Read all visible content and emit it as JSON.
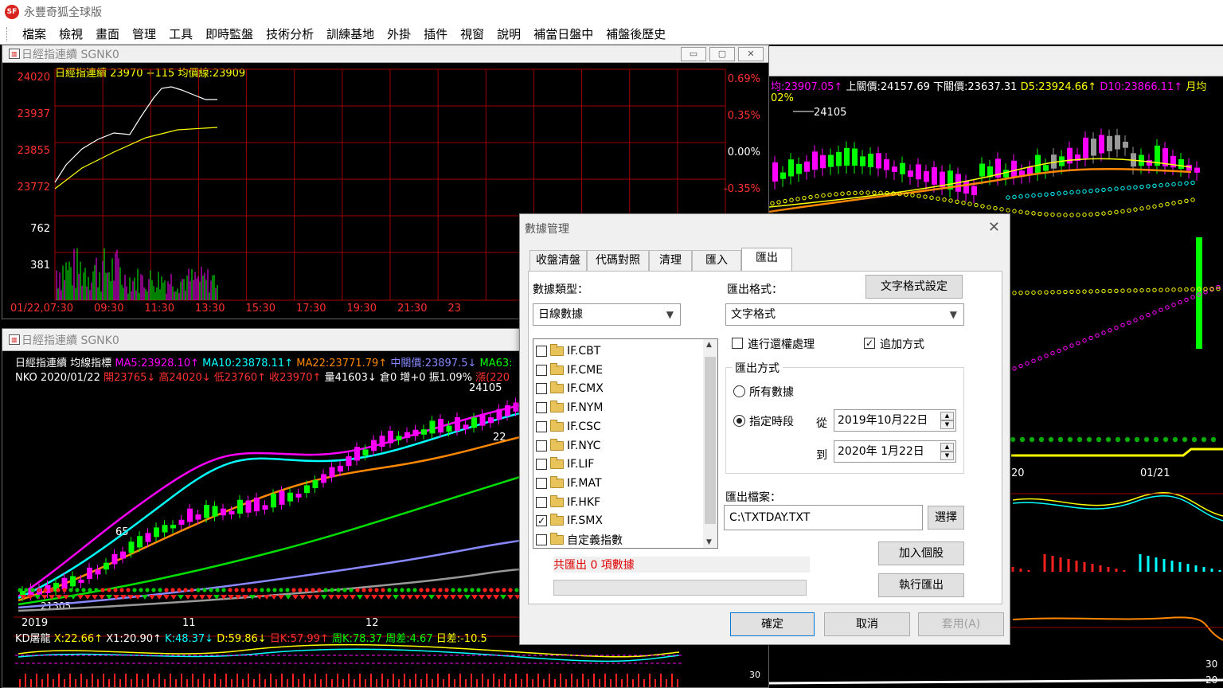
{
  "app": {
    "title": "永豐奇狐全球版",
    "logo": "SF"
  },
  "menu": [
    "檔案",
    "檢視",
    "畫面",
    "管理",
    "工具",
    "即時監盤",
    "技術分析",
    "訓練基地",
    "外掛",
    "插件",
    "視窗",
    "說明",
    "補當日盤中",
    "補盤後歷史"
  ],
  "win1": {
    "title": "日經指連續 SGNK0",
    "header": "日經指連續 23970 +115 均價線:23909",
    "price_ticks": [
      "24020",
      "23937",
      "23855",
      "23772"
    ],
    "pct_ticks": [
      "0.69%",
      "0.35%",
      "0.00%",
      "-0.35%"
    ],
    "vol_ticks": [
      "762",
      "381"
    ],
    "time_ticks": [
      "01/22,07:30",
      "09:30",
      "11:30",
      "13:30",
      "15:30",
      "17:30",
      "19:30",
      "21:30",
      "23"
    ]
  },
  "win2": {
    "title": "日經指連續 SGNK0",
    "header_name": "日經指連續",
    "header_ind": "均線指標",
    "ma5": "MA5:23928.10↑",
    "ma10": "MA10:23878.11↑",
    "ma22": "MA22:23771.79↑",
    "mid": "中關價:23897.5↓",
    "ma63": "MA63:",
    "info_code": "NKO",
    "info_date": "2020/01/22",
    "info_open": "開23765↓",
    "info_high": "高24020↓",
    "info_low": "低23760↑",
    "info_close": "收23970↑",
    "info_vol": "量41603↓",
    "info_oi": "倉0",
    "info_chg": "增+0",
    "info_amp": "振1.09%",
    "info_rise": "漲(220",
    "annot_high": "24105",
    "annot_65": "65",
    "annot_22": "22",
    "annot_low": "21305",
    "dates": [
      "2019",
      "11",
      "12"
    ],
    "kd_name": "KD屠龍",
    "kd_x": "X:22.66↑",
    "kd_x1": "X1:20.90↑",
    "kd_k": "K:48.37↓",
    "kd_d": "D:59.86↓",
    "kd_dayk": "日K:57.99↑",
    "kd_weekk": "周K:78.37",
    "kd_diff": "周差:4.67",
    "kd_daydiff": "日差:-10.5"
  },
  "win3": {
    "header_avg": "均:23907.05↑",
    "header_up": "上關價:24157.69",
    "header_down": "下關價:23637.31",
    "header_d5": "D5:23924.66↑",
    "header_d10": "D10:23866.11↑",
    "header_month": "月均",
    "pct_label": "02%",
    "high": "24105",
    "dates": [
      "20",
      "01/21"
    ],
    "right_ticks": [
      "30",
      "20"
    ]
  },
  "dialog": {
    "title": "數據管理",
    "tabs": [
      "收盤清盤",
      "代碼對照",
      "清理",
      "匯入",
      "匯出"
    ],
    "active_tab": "匯出",
    "data_type_label": "數據類型：",
    "data_type_value": "日線數據",
    "export_format_label": "匯出格式：",
    "text_format_button": "文字格式設定",
    "export_format_value": "文字格式",
    "rights_label": "進行還權處理",
    "rights_checked": false,
    "append_label": "追加方式",
    "append_checked": true,
    "method_group": "匯出方式",
    "all_data_label": "所有數據",
    "period_label": "指定時段",
    "from_label": "從",
    "to_label": "到",
    "from_date": "2019年10月22日",
    "to_date": "2020年  1月22日",
    "export_file_label": "匯出檔案：",
    "export_file_value": "C:\\TXTDAY.TXT",
    "choose_button": "選擇",
    "add_stock_button": "加入個股",
    "run_export_button": "執行匯出",
    "status": "共匯出 0 項數據",
    "ok_button": "確定",
    "cancel_button": "取消",
    "apply_button": "套用(A)",
    "items": [
      {
        "label": "IF.CBT",
        "checked": false
      },
      {
        "label": "IF.CME",
        "checked": false
      },
      {
        "label": "IF.CMX",
        "checked": false
      },
      {
        "label": "IF.NYM",
        "checked": false
      },
      {
        "label": "IF.CSC",
        "checked": false
      },
      {
        "label": "IF.NYC",
        "checked": false
      },
      {
        "label": "IF.LIF",
        "checked": false
      },
      {
        "label": "IF.MAT",
        "checked": false
      },
      {
        "label": "IF.HKF",
        "checked": false
      },
      {
        "label": "IF.SMX",
        "checked": true
      },
      {
        "label": "自定義指數",
        "checked": false
      }
    ]
  },
  "colors": {
    "grid_red": "#a00000",
    "price_line": "#ffffff",
    "avg_line": "#ffff00",
    "up": "#ff00ff",
    "down": "#00ff00"
  }
}
